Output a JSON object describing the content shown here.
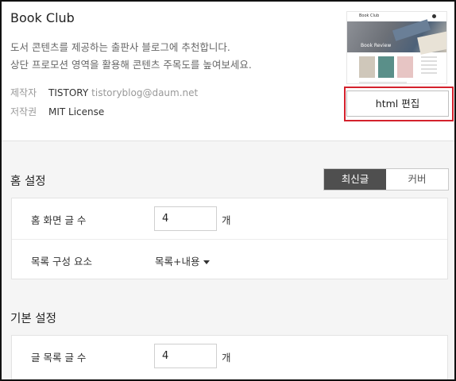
{
  "skin": {
    "name": "Book Club",
    "description_lines": [
      "도서 콘텐츠를 제공하는 출판사 블로그에 추천합니다.",
      "상단 프로모션 영역을 활용해 콘텐츠 주목도를 높여보세요."
    ],
    "author_label": "제작자",
    "author_name": "TISTORY",
    "author_email": "tistoryblog@daum.net",
    "license_label": "저작권",
    "license_value": "MIT License",
    "thumbnail": {
      "logo_text": "Book Club",
      "hero_text": "Book Review"
    },
    "html_edit_label": "html 편집"
  },
  "home_settings": {
    "title": "홈 설정",
    "tabs": [
      {
        "label": "최신글",
        "active": true
      },
      {
        "label": "커버",
        "active": false
      }
    ],
    "rows": {
      "count_label": "홈 화면 글 수",
      "count_value": "4",
      "count_unit": "개",
      "composition_label": "목록 구성 요소",
      "composition_value": "목록+내용"
    }
  },
  "basic_settings": {
    "title": "기본 설정",
    "rows": {
      "count_label": "글 목록 글 수",
      "count_value": "4",
      "count_unit": "개"
    }
  },
  "colors": {
    "highlight": "#d4212c",
    "tab_active_bg": "#4f4f4f"
  }
}
